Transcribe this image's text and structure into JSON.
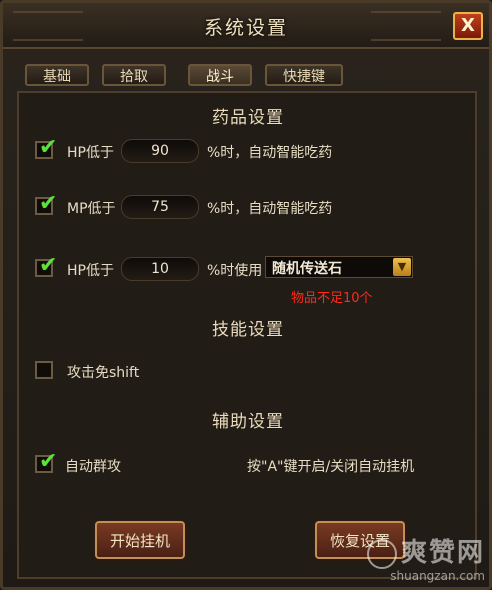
{
  "window": {
    "title": "系统设置",
    "close_label": "X"
  },
  "tabs": [
    {
      "label": "基础"
    },
    {
      "label": "拾取"
    },
    {
      "label": "战斗",
      "active": true
    },
    {
      "label": "快捷键"
    }
  ],
  "medicine": {
    "heading": "药品设置",
    "hp_row": {
      "checked": true,
      "label": "HP低于",
      "value": "90",
      "suffix": "%时，自动智能吃药"
    },
    "mp_row": {
      "checked": true,
      "label": "MP低于",
      "value": "75",
      "suffix": "%时，自动智能吃药"
    },
    "tele_row": {
      "checked": true,
      "label": "HP低于",
      "value": "10",
      "suffix": "%时使用",
      "item_select": "随机传送石",
      "warning": "物品不足10个"
    }
  },
  "skills": {
    "heading": "技能设置",
    "shift_free": {
      "checked": false,
      "label": "攻击免shift"
    }
  },
  "assist": {
    "heading": "辅助设置",
    "auto_group": {
      "checked": true,
      "label": "自动群攻"
    },
    "hint": "按\"A\"键开启/关闭自动挂机"
  },
  "buttons": {
    "start": "开始挂机",
    "restore": "恢复设置"
  },
  "watermark": {
    "main": "爽赞网",
    "sub": "shuangzan.com"
  },
  "colors": {
    "accent_check": "#5fe03a",
    "warning": "#ff2a1a",
    "gold": "#e8b44a"
  }
}
